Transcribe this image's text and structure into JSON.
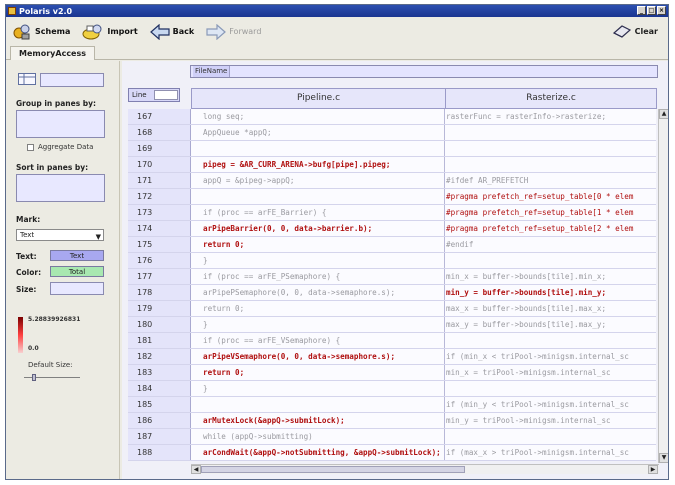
{
  "window": {
    "title": "Polaris v2.0"
  },
  "toolbar": {
    "schema": "Schema",
    "import": "Import",
    "back": "Back",
    "forward": "Forward",
    "clear": "Clear"
  },
  "tabs": [
    "MemoryAccess"
  ],
  "left": {
    "group_label": "Group in panes by:",
    "aggregate_label": "Aggregate Data",
    "sort_label": "Sort in panes by:",
    "mark_label": "Mark:",
    "mark_value": "Text",
    "text_label": "Text:",
    "text_swatch": "Text",
    "color_label": "Color:",
    "color_swatch": "Total",
    "size_label": "Size:",
    "legend_max": "5.28839926831",
    "legend_min": "0.0",
    "default_size_label": "Default Size:"
  },
  "main": {
    "filename_label": "FileName",
    "line_label": "Line",
    "col_a": "Pipeline.c",
    "col_b": "Rasterize.c"
  },
  "rows": [
    {
      "num": "167",
      "a": "long seq;",
      "b": "rasterFunc    = rasterInfo->rasterize;"
    },
    {
      "num": "168",
      "a": "AppQueue *appQ;",
      "b": ""
    },
    {
      "num": "169",
      "a": "",
      "b": ""
    },
    {
      "num": "170",
      "a": "pipeg = &AR_CURR_ARENA->bufg[pipe].pipeg;",
      "b": ""
    },
    {
      "num": "171",
      "a": "appQ = &pipeg->appQ;",
      "b": "#ifdef AR_PREFETCH"
    },
    {
      "num": "172",
      "a": "",
      "b": "#pragma prefetch_ref=setup_table[0 * elem"
    },
    {
      "num": "173",
      "a": "if (proc == arFE_Barrier) {",
      "b": "#pragma prefetch_ref=setup_table[1 * elem"
    },
    {
      "num": "174",
      "a": "    arPipeBarrier(0, 0, data->barrier.b);",
      "b": "#pragma prefetch_ref=setup_table[2 * elem"
    },
    {
      "num": "175",
      "a": "    return 0;",
      "b": "#endif"
    },
    {
      "num": "176",
      "a": "}",
      "b": ""
    },
    {
      "num": "177",
      "a": "if (proc == arFE_PSemaphore) {",
      "b": "    min_x = buffer->bounds[tile].min_x;"
    },
    {
      "num": "178",
      "a": "    arPipePSemaphore(0, 0, data->semaphore.s);",
      "b": "    min_y = buffer->bounds[tile].min_y;"
    },
    {
      "num": "179",
      "a": "    return 0;",
      "b": "    max_x = buffer->bounds[tile].max_x;"
    },
    {
      "num": "180",
      "a": "}",
      "b": "    max_y = buffer->bounds[tile].max_y;"
    },
    {
      "num": "181",
      "a": "if (proc == arFE_VSemaphore) {",
      "b": ""
    },
    {
      "num": "182",
      "a": "    arPipeVSemaphore(0, 0, data->semaphore.s);",
      "b": "    if (min_x < triPool->minigsm.internal_sc"
    },
    {
      "num": "183",
      "a": "    return 0;",
      "b": "        min_x = triPool->minigsm.internal_sc"
    },
    {
      "num": "184",
      "a": "}",
      "b": ""
    },
    {
      "num": "185",
      "a": "",
      "b": "    if (min_y < triPool->minigsm.internal_sc"
    },
    {
      "num": "186",
      "a": "arMutexLock(&appQ->submitLock);",
      "b": "        min_y = triPool->minigsm.internal_sc"
    },
    {
      "num": "187",
      "a": "while (appQ->submitting)",
      "b": ""
    },
    {
      "num": "188",
      "a": "    arCondWait(&appQ->notSubmitting, &appQ->submitLock);",
      "b": "    if (max_x > triPool->minigsm.internal_sc"
    }
  ],
  "row_styles": {
    "a": [
      "grey",
      "grey",
      "grey",
      "red",
      "grey",
      "grey",
      "grey",
      "red",
      "red",
      "grey",
      "grey",
      "grey",
      "grey",
      "grey",
      "grey",
      "red",
      "red",
      "grey",
      "grey",
      "red",
      "grey",
      "red"
    ],
    "b": [
      "grey",
      "grey",
      "grey",
      "grey",
      "grey",
      "hl",
      "hl",
      "hl",
      "grey",
      "grey",
      "grey",
      "red",
      "grey",
      "grey",
      "grey",
      "grey",
      "grey",
      "grey",
      "grey",
      "grey",
      "grey",
      "grey"
    ]
  },
  "colors": {
    "titlebar": "#1a3590",
    "lavender": "#e8e8ff",
    "hot_text": "#b01010",
    "cold_text": "#9a9aa0",
    "text_swatch": "#a8a8f0",
    "color_swatch": "#a8e8b0"
  }
}
